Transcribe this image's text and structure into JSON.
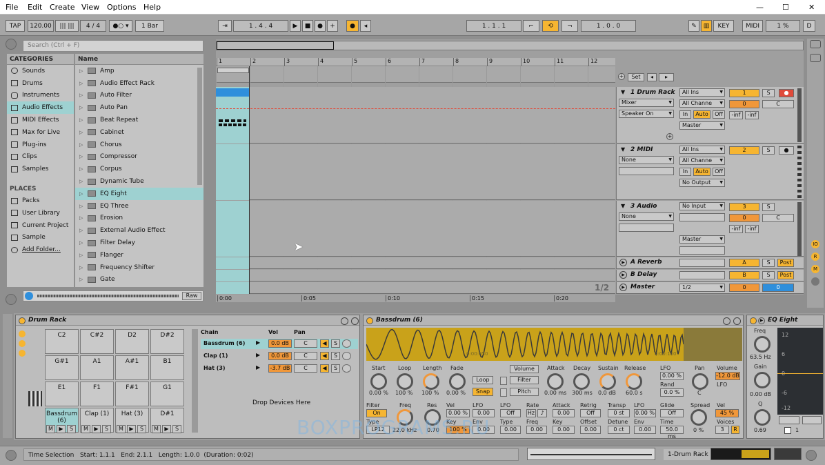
{
  "menu": [
    "File",
    "Edit",
    "Create",
    "View",
    "Options",
    "Help"
  ],
  "window_controls": [
    "—",
    "☐",
    "✕"
  ],
  "transport": {
    "tap": "TAP",
    "tempo": "120.00",
    "sig": "4 / 4",
    "quant": "1 Bar",
    "pos": "1 .   4 .   4",
    "loop_start": "1 .   1 .   1",
    "loop_len": "1 .   0 .   0",
    "key": "KEY",
    "midi": "MIDI",
    "cpu": "1 %",
    "d": "D"
  },
  "browser": {
    "search_placeholder": "Search (Ctrl + F)",
    "categories_title": "CATEGORIES",
    "categories": [
      "Sounds",
      "Drums",
      "Instruments",
      "Audio Effects",
      "MIDI Effects",
      "Max for Live",
      "Plug-ins",
      "Clips",
      "Samples"
    ],
    "places_title": "PLACES",
    "places": [
      "Packs",
      "User Library",
      "Current Project",
      "Sample",
      "Add Folder..."
    ],
    "name_header": "Name",
    "items": [
      "Amp",
      "Audio Effect Rack",
      "Auto Filter",
      "Auto Pan",
      "Beat Repeat",
      "Cabinet",
      "Chorus",
      "Compressor",
      "Corpus",
      "Dynamic Tube",
      "EQ Eight",
      "EQ Three",
      "Erosion",
      "External Audio Effect",
      "Filter Delay",
      "Flanger",
      "Frequency Shifter",
      "Gate"
    ],
    "raw": "Raw"
  },
  "arrangement": {
    "bars": [
      "1",
      "2",
      "3",
      "4",
      "5",
      "6",
      "7",
      "8",
      "9",
      "10",
      "11",
      "12"
    ],
    "set": "Set",
    "time_marks": [
      "0:00",
      "0:05",
      "0:10",
      "0:15",
      "0:20"
    ],
    "zoom": "1/2"
  },
  "tracks": [
    {
      "name": "1 Drum Rack",
      "num": "1",
      "in": "All Ins",
      "ch": "All Channe",
      "mon": "Mixer",
      "sub": "Speaker On",
      "out": "Master",
      "vol": "0",
      "pan": "C",
      "inf1": "-inf",
      "inf2": "-inf",
      "s": "S"
    },
    {
      "name": "2 MIDI",
      "num": "2",
      "in": "All Ins",
      "ch": "All Channe",
      "mon": "None",
      "out": "No Output",
      "s": "S"
    },
    {
      "name": "3 Audio",
      "num": "3",
      "in": "No Input",
      "mon": "None",
      "out": "Master",
      "vol": "0",
      "pan": "C",
      "inf1": "-inf",
      "inf2": "-inf",
      "s": "S"
    }
  ],
  "returns": [
    {
      "name": "A Reverb",
      "num": "A",
      "s": "S",
      "post": "Post"
    },
    {
      "name": "B Delay",
      "num": "B",
      "s": "S",
      "post": "Post"
    },
    {
      "name": "Master",
      "out": "1/2",
      "vol": "0",
      "pan": "0"
    }
  ],
  "monitor": {
    "in": "In",
    "auto": "Auto",
    "off": "Off"
  },
  "drum_rack": {
    "title": "Drum Rack",
    "pads": [
      [
        "C2",
        "C#2",
        "D2",
        "D#2"
      ],
      [
        "G#1",
        "A1",
        "A#1",
        "B1"
      ],
      [
        "E1",
        "F1",
        "F#1",
        "G1"
      ],
      [
        "Bassdrum (6)",
        "Clap (1)",
        "Hat (3)",
        "D#1"
      ]
    ],
    "pad_buttons": [
      "M",
      "▶",
      "S"
    ],
    "chain_header": "Chain",
    "vol_header": "Vol",
    "pan_header": "Pan",
    "chains": [
      {
        "name": "Bassdrum (6)",
        "vol": "0.0 dB",
        "pan": "C"
      },
      {
        "name": "Clap (1)",
        "vol": "0.0 dB",
        "pan": "C"
      },
      {
        "name": "Hat (3)",
        "vol": "-3.7 dB",
        "pan": "C"
      }
    ],
    "chain_s": "S",
    "drop": "Drop Devices Here"
  },
  "sampler": {
    "title": "Bassdrum (6)",
    "wave_marks": [
      "0:00:050",
      "0:00:100"
    ],
    "labels": {
      "start": "Start",
      "loop": "Loop",
      "length": "Length",
      "fade": "Fade",
      "filter": "Filter",
      "freq": "Freq",
      "res": "Res",
      "vel": "Vel",
      "lfo": "LFO",
      "type": "Type",
      "key": "Key",
      "env": "Env",
      "rate": "Rate",
      "attack": "Attack",
      "retrig": "Retrig",
      "transp": "Transp",
      "detune": "Detune",
      "glide": "Glide",
      "time": "Time",
      "decay": "Decay",
      "sustain": "Sustain",
      "release": "Release",
      "rand": "Rand",
      "pan": "Pan",
      "spread": "Spread",
      "volume": "Volume",
      "voices": "Voices",
      "offset": "Offset"
    },
    "values": {
      "start": "0.00 %",
      "loop": "100 %",
      "length": "100 %",
      "fade": "0.00 %",
      "filter_on": "On",
      "filter_type": "LP12",
      "freq": "22.0 kHz",
      "res": "0.70",
      "vel": "0.00 %",
      "key": "100 %",
      "lfo": "0.00",
      "attack": "0.00 ms",
      "decay": "300 ms",
      "sustain": "0.0 dB",
      "release": "60.0 s",
      "lfo_off": "Off",
      "lfo_val": "0.00 %",
      "rand_val": "0.0 %",
      "pan": "C",
      "hz": "Hz",
      "note": "♪",
      "retrig": "Off",
      "transp": "0 st",
      "detune": "0 ct",
      "env": "0.00 %",
      "glide": "Off",
      "time": "50.0 ms",
      "spread": "0 %",
      "volume": "-12.0 dB",
      "vel2": "45 %",
      "voices": "3",
      "r": "R"
    },
    "buttons": {
      "loop": "Loop",
      "snap": "Snap",
      "volume": "Volume",
      "filter": "Filter",
      "pitch": "Pitch"
    }
  },
  "eq": {
    "title": "EQ Eight",
    "freq": "Freq",
    "freq_val": "63.5 Hz",
    "gain": "Gain",
    "gain_val": "0.00 dB",
    "q": "Q",
    "q_val": "0.69",
    "scale": [
      "12",
      "6",
      "0",
      "-6",
      "-12"
    ],
    "band": "1"
  },
  "status": {
    "text": "Time Selection   Start: 1.1.1   End: 2.1.1   Length: 1.0.0  (Duration: 0:02)",
    "track": "1-Drum Rack"
  },
  "watermark": "BOXPROGRAMS.RU",
  "colors": {
    "accent": "#f6b531",
    "orange": "#f0973a",
    "selection": "#9ed1d1",
    "clip": "#2f8fdc"
  }
}
